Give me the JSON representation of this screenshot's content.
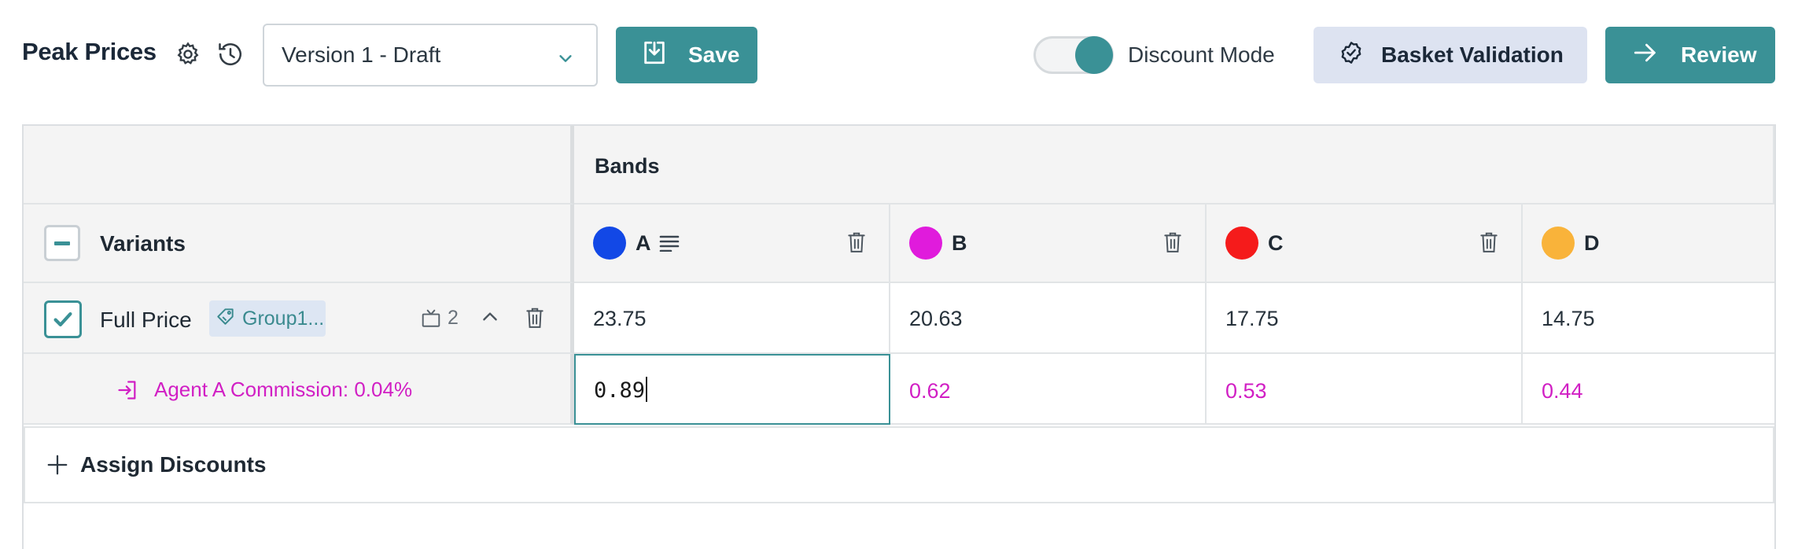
{
  "header": {
    "title": "Peak Prices",
    "version_select": {
      "value": "Version 1 - Draft"
    },
    "save_label": "Save",
    "discount_mode": {
      "label": "Discount Mode",
      "on": true
    },
    "basket_label": "Basket Validation",
    "review_label": "Review"
  },
  "grid": {
    "bands_header": "Bands",
    "variants_header": "Variants",
    "bands": [
      {
        "name": "A",
        "color": "#1248e6"
      },
      {
        "name": "B",
        "color": "#e01bdc"
      },
      {
        "name": "C",
        "color": "#f51b1b"
      },
      {
        "name": "D",
        "color": "#f9b33a"
      }
    ],
    "rows": [
      {
        "label": "Full Price",
        "tag": "Group1...",
        "count": "2",
        "checked": true,
        "values": [
          "23.75",
          "20.63",
          "17.75",
          "14.75"
        ]
      },
      {
        "label": "Agent A Commission: 0.04%",
        "values": [
          "0.89",
          "0.62",
          "0.53",
          "0.44"
        ],
        "text_color": "#d11fc4"
      }
    ],
    "assign_label": "Assign Discounts"
  },
  "colors": {
    "accent": "#3a9196",
    "secondary_button": "#dde3f1",
    "commission": "#d11fc4"
  },
  "icons": {
    "settings": "gear-icon",
    "history": "history-icon",
    "dropdown": "chevron-down-icon",
    "save": "save-download-icon",
    "basket": "badge-check-icon",
    "review": "arrow-right-icon",
    "delete": "trash-icon",
    "tag": "tag-icon",
    "count": "tv-icon",
    "collapse": "chevron-up-icon",
    "agent": "login-icon",
    "add": "plus-icon",
    "band_details": "text-lines-icon"
  }
}
